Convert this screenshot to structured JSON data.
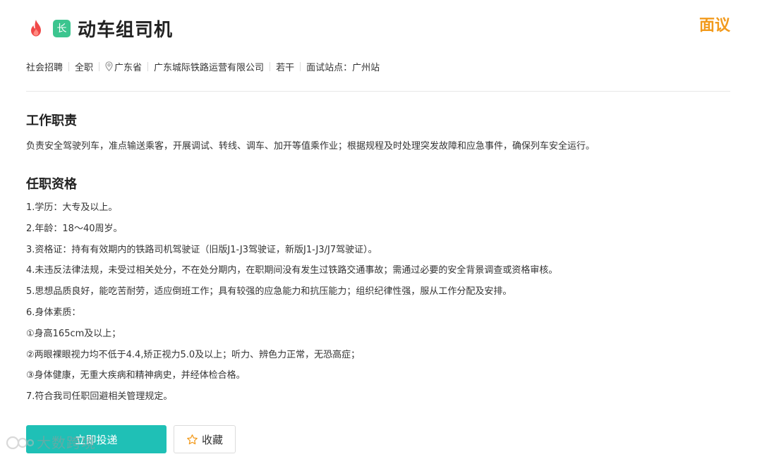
{
  "header": {
    "fire_icon": "fire-icon",
    "tag_text": "长",
    "title": "动车组司机",
    "salary": "面议"
  },
  "meta": {
    "type": "社会招聘",
    "employment": "全职",
    "location": "广东省",
    "company": "广东城际铁路运营有限公司",
    "headcount": "若干",
    "interview_site": "面试站点：广州站"
  },
  "duties": {
    "title": "工作职责",
    "text": "负责安全驾驶列车，准点输送乘客，开展调试、转线、调车、加开等值乘作业；根据规程及时处理突发故障和应急事件，确保列车安全运行。"
  },
  "requirements": {
    "title": "任职资格",
    "items": [
      "1.学历：大专及以上。",
      "2.年龄：18～40周岁。",
      "3.资格证：持有有效期内的铁路司机驾驶证（旧版J1-J3驾驶证，新版J1-J3/J7驾驶证）。",
      "4.未违反法律法规，未受过相关处分，不在处分期内，在职期间没有发生过铁路交通事故；需通过必要的安全背景调查或资格审核。",
      "5.思想品质良好，能吃苦耐劳，适应倒班工作；具有较强的应急能力和抗压能力；组织纪律性强，服从工作分配及安排。",
      "6.身体素质：",
      "①身高165cm及以上；",
      "②两眼裸眼视力均不低于4.4,矫正视力5.0及以上；听力、辨色力正常，无恐高症；",
      "③身体健康，无重大疾病和精神病史，并经体检合格。",
      "7.符合我司任职回避相关管理规定。"
    ]
  },
  "actions": {
    "apply_label": "立即投递",
    "favorite_label": "收藏"
  },
  "watermark": {
    "text": "大数跨境"
  },
  "colors": {
    "accent_teal": "#1fc0b6",
    "tag_green": "#3cc58f",
    "salary_orange": "#f29a1c",
    "fire_red": "#f04848"
  }
}
